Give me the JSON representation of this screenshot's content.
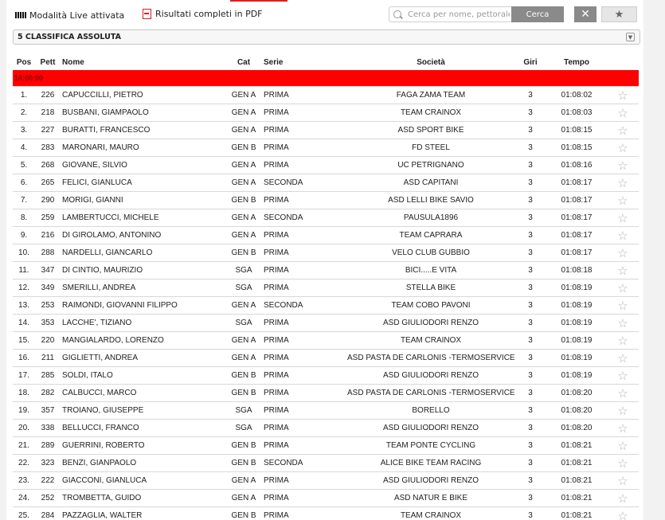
{
  "toolbar": {
    "live_label": "Modalità Live attivata",
    "pdf_label": "Risultati completi in PDF",
    "search_placeholder": "Cerca per nome, pettorale, soc",
    "search_button": "Cerca",
    "clear_button": "✕",
    "favorite_button": "★"
  },
  "classification": {
    "selected": "5 CLASSIFICA ASSOLUTA"
  },
  "table": {
    "columns": [
      "Pos",
      "Pett",
      "Nome",
      "Cat",
      "Serie",
      "Società",
      "Giri",
      "Tempo"
    ],
    "group_label": "14:00:00",
    "rows": [
      [
        "1.",
        "226",
        "CAPUCCILLI, PIETRO",
        "GEN A",
        "PRIMA",
        "FAGA ZAMA TEAM",
        "3",
        "01:08:02"
      ],
      [
        "2.",
        "218",
        "BUSBANI, GIAMPAOLO",
        "GEN A",
        "PRIMA",
        "TEAM CRAINOX",
        "3",
        "01:08:03"
      ],
      [
        "3.",
        "227",
        "BURATTI, FRANCESCO",
        "GEN A",
        "PRIMA",
        "ASD SPORT BIKE",
        "3",
        "01:08:15"
      ],
      [
        "4.",
        "283",
        "MARONARI, MAURO",
        "GEN B",
        "PRIMA",
        "FD STEEL",
        "3",
        "01:08:15"
      ],
      [
        "5.",
        "268",
        "GIOVANE, SILVIO",
        "GEN A",
        "PRIMA",
        "UC PETRIGNANO",
        "3",
        "01:08:16"
      ],
      [
        "6.",
        "265",
        "FELICI, GIANLUCA",
        "GEN A",
        "SECONDA",
        "ASD CAPITANI",
        "3",
        "01:08:17"
      ],
      [
        "7.",
        "290",
        "MORIGI, GIANNI",
        "GEN B",
        "PRIMA",
        "ASD LELLI BIKE SAVIO",
        "3",
        "01:08:17"
      ],
      [
        "8.",
        "259",
        "LAMBERTUCCI, MICHELE",
        "GEN A",
        "SECONDA",
        "PAUSULA1896",
        "3",
        "01:08:17"
      ],
      [
        "9.",
        "216",
        "DI GIROLAMO, ANTONINO",
        "GEN A",
        "PRIMA",
        "TEAM CAPRARA",
        "3",
        "01:08:17"
      ],
      [
        "10.",
        "288",
        "NARDELLI, GIANCARLO",
        "GEN B",
        "PRIMA",
        "VELO CLUB GUBBIO",
        "3",
        "01:08:17"
      ],
      [
        "11.",
        "347",
        "DI CINTIO, MAURIZIO",
        "SGA",
        "PRIMA",
        "BICI.....E VITA",
        "3",
        "01:08:18"
      ],
      [
        "12.",
        "349",
        "SMERILLI, ANDREA",
        "SGA",
        "PRIMA",
        "STELLA BIKE",
        "3",
        "01:08:19"
      ],
      [
        "13.",
        "253",
        "RAIMONDI, GIOVANNI FILIPPO",
        "GEN A",
        "SECONDA",
        "TEAM COBO PAVONI",
        "3",
        "01:08:19"
      ],
      [
        "14.",
        "353",
        "LACCHE', TIZIANO",
        "SGA",
        "PRIMA",
        "ASD GIULIODORI RENZO",
        "3",
        "01:08:19"
      ],
      [
        "15.",
        "220",
        "MANGIALARDO, LORENZO",
        "GEN A",
        "PRIMA",
        "TEAM CRAINOX",
        "3",
        "01:08:19"
      ],
      [
        "16.",
        "211",
        "GIGLIETTI, ANDREA",
        "GEN A",
        "PRIMA",
        "ASD PASTA DE CARLONIS -TERMOSERVICEGAS",
        "3",
        "01:08:19"
      ],
      [
        "17.",
        "285",
        "SOLDI, ITALO",
        "GEN B",
        "PRIMA",
        "ASD GIULIODORI RENZO",
        "3",
        "01:08:19"
      ],
      [
        "18.",
        "282",
        "CALBUCCI, MARCO",
        "GEN B",
        "PRIMA",
        "ASD PASTA DE CARLONIS -TERMOSERVICEGAS",
        "3",
        "01:08:20"
      ],
      [
        "19.",
        "357",
        "TROIANO, GIUSEPPE",
        "SGA",
        "PRIMA",
        "BORELLO",
        "3",
        "01:08:20"
      ],
      [
        "20.",
        "338",
        "BELLUCCI, FRANCO",
        "SGA",
        "PRIMA",
        "ASD GIULIODORI RENZO",
        "3",
        "01:08:20"
      ],
      [
        "21.",
        "289",
        "GUERRINI, ROBERTO",
        "GEN B",
        "PRIMA",
        "TEAM PONTE CYCLING",
        "3",
        "01:08:21"
      ],
      [
        "22.",
        "323",
        "BENZI, GIANPAOLO",
        "GEN B",
        "SECONDA",
        "ALICE BIKE TEAM RACING",
        "3",
        "01:08:21"
      ],
      [
        "23.",
        "222",
        "GIACCONI, GIANLUCA",
        "GEN A",
        "PRIMA",
        "ASD GIULIODORI RENZO",
        "3",
        "01:08:21"
      ],
      [
        "24.",
        "252",
        "TROMBETTA, GUIDO",
        "GEN A",
        "PRIMA",
        "ASD NATUR E BIKE",
        "3",
        "01:08:21"
      ],
      [
        "25.",
        "284",
        "PAZZAGLIA, WALTER",
        "GEN B",
        "PRIMA",
        "TEAM CRAINOX",
        "3",
        "01:08:21"
      ]
    ]
  },
  "icons": {
    "live": "live-signal-icon",
    "pdf": "pdf-file-icon",
    "search": "search-icon",
    "row_favorite": "star-outline-icon"
  },
  "colors": {
    "accent": "#ff0000",
    "button": "#8a8a8a"
  }
}
